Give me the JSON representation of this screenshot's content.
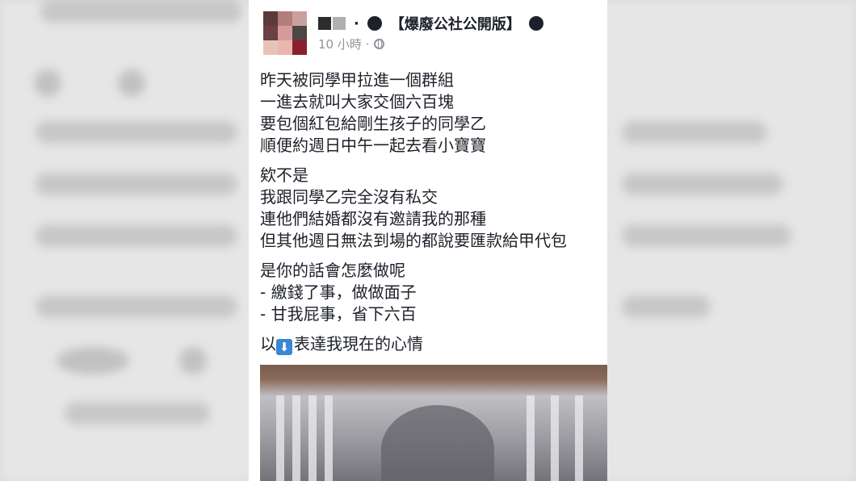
{
  "post": {
    "author_prefix": "·",
    "group_name": "【爆廢公社公開版】",
    "timestamp": "10 小時 ·",
    "paragraphs": [
      [
        "昨天被同學甲拉進一個群組",
        "一進去就叫大家交個六百塊",
        "要包個紅包給剛生孩子的同學乙",
        "順便約週日中午一起去看小寶寶"
      ],
      [
        "欸不是",
        "我跟同學乙完全沒有私交",
        "連他們結婚都沒有邀請我的那種",
        "但其他週日無法到場的都說要匯款給甲代包"
      ],
      [
        "是你的話會怎麼做呢",
        "- 繳錢了事，做做面子",
        "- 甘我屁事，省下六百"
      ]
    ],
    "last_line_prefix": "以",
    "last_line_emoji": "⬇",
    "last_line_suffix": "表達我現在的心情"
  },
  "colors": {
    "text": "#1d2129",
    "meta": "#90949c",
    "emoji_bg": "#3b87d6"
  },
  "icons": [
    "avatar-mosaic",
    "globe-icon",
    "down-arrow-emoji"
  ]
}
